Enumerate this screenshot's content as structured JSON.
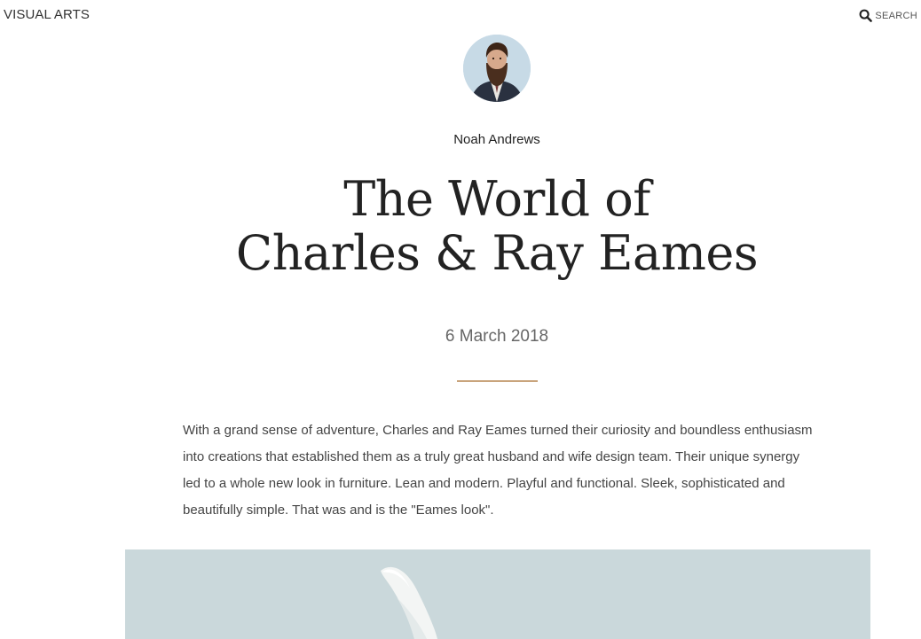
{
  "header": {
    "site_title": "VISUAL ARTS",
    "search_label": "SEARCH",
    "search_icon": "search-icon"
  },
  "article": {
    "author": "Noah Andrews",
    "title_lines": [
      "The World of",
      "Charles & Ray Eames"
    ],
    "date": "6 March 2018",
    "lead": "With a grand sense of adventure, Charles and Ray Eames turned their curiosity and boundless enthusiasm into creations that established them as a truly great husband and wife design team. Their unique synergy led to a whole new look in furniture. Lean and modern. Playful and functional. Sleek, sophisticated and beautifully simple. That was and is the \"Eames look\"."
  },
  "colors": {
    "accent_divider": "#c9a47c",
    "text_dark": "#222222",
    "hero_bg": "#cbd9dc"
  }
}
